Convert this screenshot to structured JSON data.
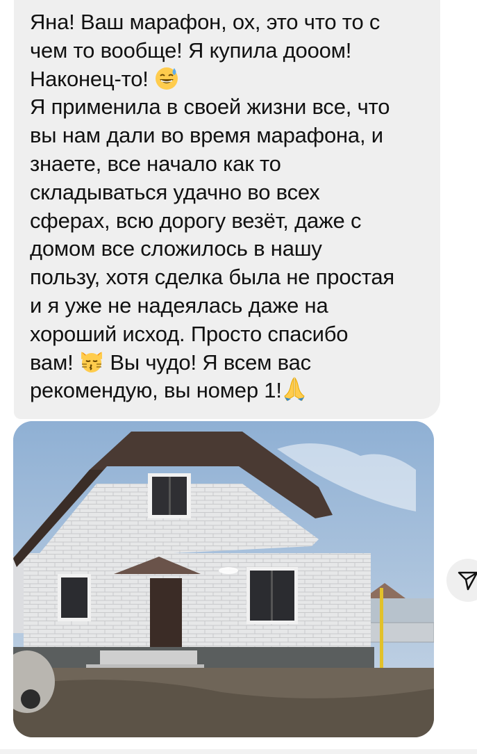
{
  "message": {
    "lines": [
      "Яна! Ваш марафон, ох, это что то с",
      "чем то вообще! Я купила дооом!",
      "Наконец-то!",
      "Я применила в своей жизни все, что",
      "вы нам дали во время марафона, и",
      "знаете, все начало как то",
      "складываться удачно во всех",
      "сферах, всю дорогу везёт, даже с",
      "домом все сложилось в нашу",
      "пользу, хотя сделка была не простая",
      "и я уже не надеялась даже на",
      "хороший исход. Просто спасибо",
      "вам!",
      "Вы чудо! Я всем вас",
      "рекомендую, вы номер 1!"
    ],
    "emojis": [
      "sweat-smile-emoji",
      "kissing-cat-emoji",
      "folded-hands-emoji"
    ]
  },
  "attachment": {
    "icon": "photo-of-house",
    "colors": {
      "sky": "#a9c2dc",
      "wall": "#e4e5e6",
      "roof": "#4a3a33",
      "ground": "#6f6558"
    }
  },
  "share_button": {
    "icon": "share-icon"
  },
  "colors": {
    "bubble": "#efefef",
    "text": "#111111"
  }
}
